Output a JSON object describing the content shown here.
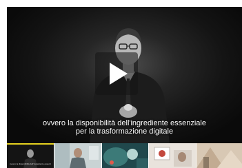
{
  "player": {
    "subtitle_line1": "ovvero la disponibilità dell'ingrediente essenziale",
    "subtitle_line2": "per la trasformazione digitale",
    "play_icon": "play-icon",
    "active_color": "#e6d21f"
  },
  "thumbnails": [
    {
      "caption": "ovvero la disponibilità dell'ingrediente essenziale"
    },
    {
      "caption": ""
    },
    {
      "caption": ""
    },
    {
      "caption": ""
    },
    {
      "caption": ""
    }
  ]
}
